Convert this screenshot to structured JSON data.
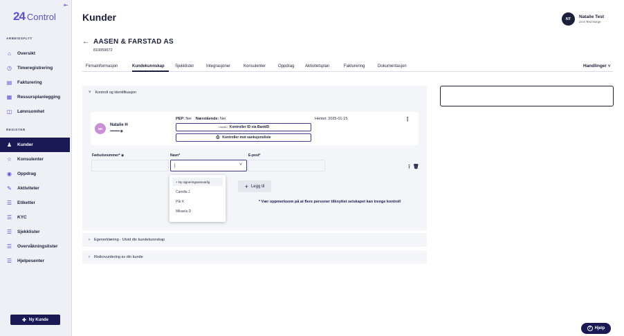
{
  "sidebar": {
    "logo_mark": "24",
    "logo_text": "Control",
    "section_workflow": "ARBEIDSFLYT",
    "workflow_items": [
      {
        "label": "Oversikt",
        "icon": "home-icon"
      },
      {
        "label": "Timeregistrering",
        "icon": "clock-icon"
      },
      {
        "label": "Fakturering",
        "icon": "invoice-icon"
      },
      {
        "label": "Ressursplanlegging",
        "icon": "planning-icon"
      },
      {
        "label": "Lønnsomhet",
        "icon": "chart-icon"
      }
    ],
    "section_register": "REGISTER",
    "register_items": [
      {
        "label": "Kunder",
        "icon": "customer-icon",
        "active": true
      },
      {
        "label": "Konsulenter",
        "icon": "star-icon"
      },
      {
        "label": "Oppdrag",
        "icon": "check-circle-icon"
      },
      {
        "label": "Aktiviteter",
        "icon": "pen-icon"
      },
      {
        "label": "Etiketter",
        "icon": "list-icon"
      },
      {
        "label": "KYC",
        "icon": "list-icon"
      },
      {
        "label": "Sjekklister",
        "icon": "list-icon"
      },
      {
        "label": "Overvåkningslister",
        "icon": "list-icon"
      },
      {
        "label": "Hjelpesenter",
        "icon": "list-icon"
      }
    ],
    "new_customer_label": "Ny Kunde"
  },
  "header": {
    "title": "Kunder",
    "user_initials": "NT",
    "user_name": "Natalie Test",
    "user_org": "24.6 Test Norge"
  },
  "customer": {
    "name": "AASEN & FARSTAD AS",
    "org_number": "810059672"
  },
  "tabs": [
    {
      "label": "Firmainformasjon"
    },
    {
      "label": "Kundekunnskap",
      "active": true
    },
    {
      "label": "Sjekklister"
    },
    {
      "label": "Integrasjoner"
    },
    {
      "label": "Konsulenter"
    },
    {
      "label": "Oppdrag"
    },
    {
      "label": "Aktivitetsplan"
    },
    {
      "label": "Fakturering"
    },
    {
      "label": "Dokumentasjon"
    }
  ],
  "actions_label": "Handlinger",
  "section1": {
    "title": "Kontroll og identifikasjon",
    "person": {
      "initials": "NH",
      "name": "Natalie H",
      "masked": "•••••••••••",
      "pep_label": "PEP:",
      "pep_value": "Nei",
      "related_label": "Nærstående:",
      "related_value": "Nei",
      "fetched": "Hentet: 2025-01-15",
      "bankid_prefix": "⚬bankID",
      "bankid_button": "Kontroller ID via BankID",
      "sanction_button": "Kontroller mot sanksjonsliste"
    },
    "form": {
      "ssn_label": "Fødselsnummer*",
      "name_label": "Navn*",
      "email_label": "E-post*",
      "name_value": "|"
    },
    "dropdown": {
      "first": "+ Ny signeringsansvarlig",
      "options": [
        "Camilla J",
        "Pår K",
        "Mikaela D"
      ]
    },
    "add_label": "Legg til",
    "warning": "* Vær oppmerksom på at flere personer tilknyttet selskapet kan trenge kontroll"
  },
  "section2": {
    "title": "Egenerklæring - Utvid din kundekunnskap"
  },
  "section3": {
    "title": "Risikovurdering av din kunde"
  },
  "help_label": "Hjelp"
}
